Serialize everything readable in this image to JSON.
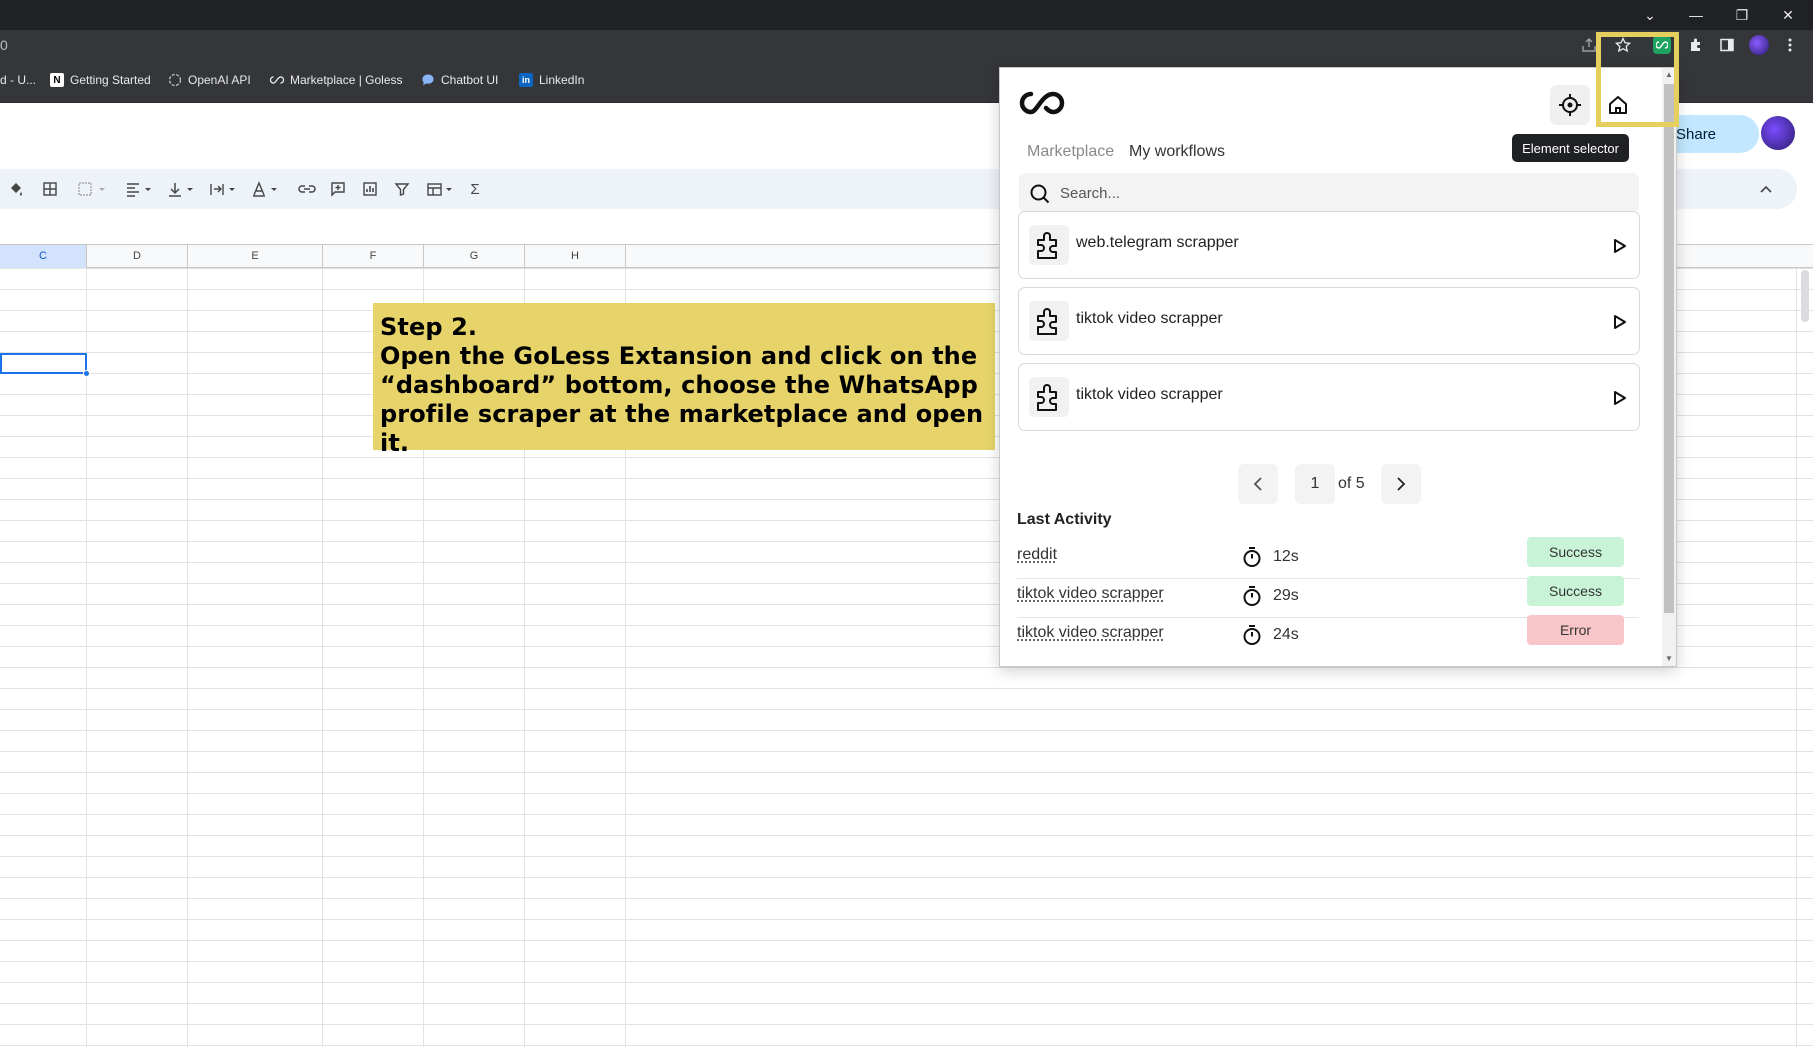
{
  "browser": {
    "url_fragment": "0",
    "bookmarks": [
      {
        "label": "d - U..."
      },
      {
        "label": "Getting Started"
      },
      {
        "label": "OpenAI API"
      },
      {
        "label": "Marketplace | Goless"
      },
      {
        "label": "Chatbot UI"
      },
      {
        "label": "LinkedIn"
      }
    ],
    "window_controls": {
      "chevron": "⌄",
      "minimize": "—",
      "restore": "❐",
      "close": "✕"
    }
  },
  "sheets": {
    "share_label": "Share",
    "columns": [
      {
        "label": "C",
        "selected": true
      },
      {
        "label": "D"
      },
      {
        "label": "E"
      },
      {
        "label": "F"
      },
      {
        "label": "G"
      },
      {
        "label": "H"
      }
    ],
    "toolbar_icons": [
      "paint-format-icon",
      "borders-icon",
      "merge-cells-icon",
      "align-icon",
      "vertical-align-icon",
      "text-wrap-icon",
      "text-rotation-icon",
      "link-icon",
      "comment-icon",
      "chart-icon",
      "filter-icon",
      "table-view-icon",
      "functions-icon"
    ]
  },
  "note": {
    "line1": "Step 2.",
    "line2": "Open the GoLess Extansion and click on the “dashboard” bottom, choose the WhatsApp profile scraper at the marketplace and open it."
  },
  "extension": {
    "tooltip": "Element selector",
    "tabs": {
      "marketplace": "Marketplace",
      "workflows": "My workflows"
    },
    "search_placeholder": "Search...",
    "workflows": [
      {
        "name": "web.telegram scrapper"
      },
      {
        "name": "tiktok video scrapper"
      },
      {
        "name": "tiktok video scrapper"
      }
    ],
    "pagination": {
      "current": "1",
      "of_label": "of 5",
      "prev": "‹",
      "next": "›"
    },
    "last_activity_title": "Last Activity",
    "activity": [
      {
        "name": "reddit",
        "time": "12s",
        "status": "Success"
      },
      {
        "name": "tiktok video scrapper",
        "time": "29s",
        "status": "Success"
      },
      {
        "name": "tiktok video scrapper",
        "time": "24s",
        "status": "Error"
      }
    ]
  },
  "colors": {
    "highlight": "#e4cf5f",
    "note_bg": "#e6d46a",
    "success": "#c8f3d6",
    "error": "#f8c5c8"
  }
}
